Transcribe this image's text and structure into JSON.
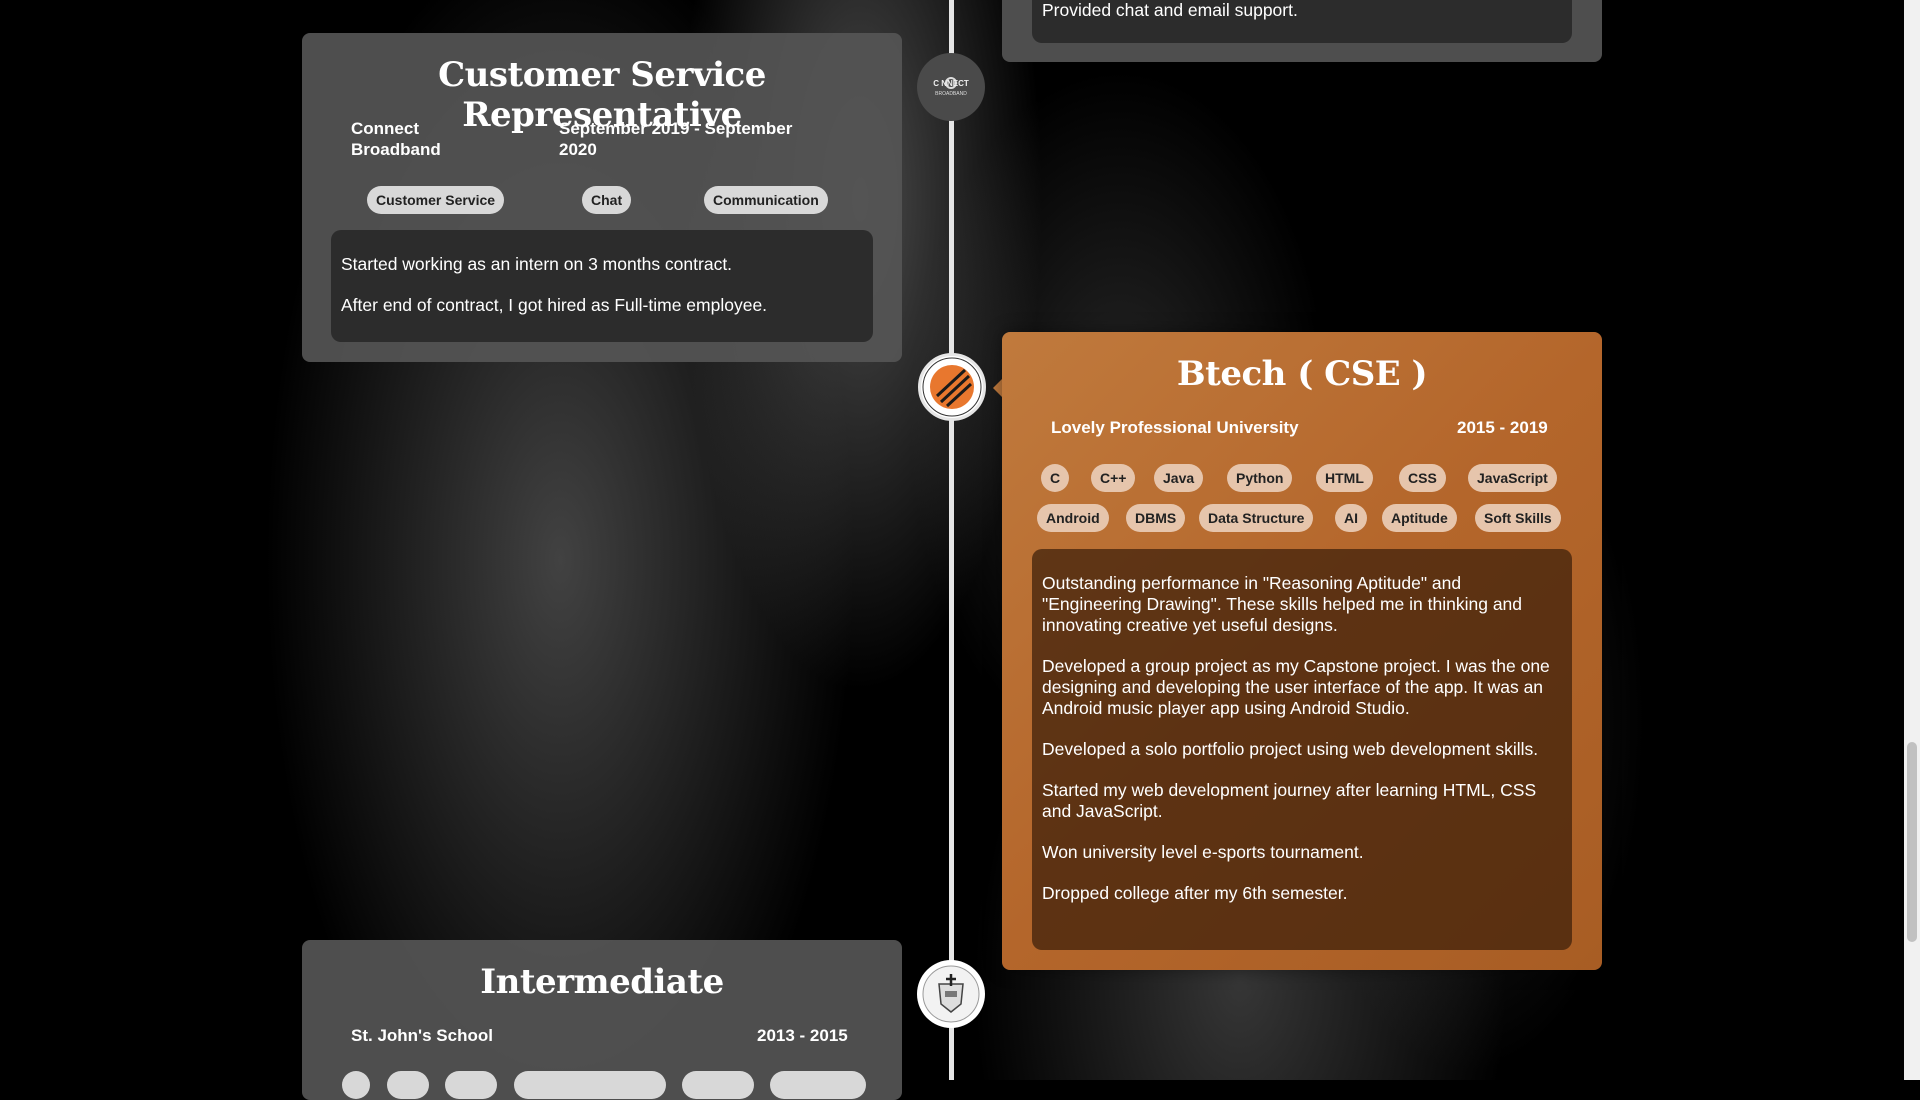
{
  "top_card": {
    "last_line": "Provided chat and email support."
  },
  "job_card": {
    "title": "Customer Service Representative",
    "company": "Connect Broadband",
    "company_line1": "Connect",
    "company_line2": "Broadband",
    "dates_line1": "September 2019 - September",
    "dates_line2": "2020",
    "tags": [
      "Customer Service",
      "Chat",
      "Communication"
    ],
    "paragraphs": [
      "Started working as an intern on 3 months contract.",
      "After end of contract, I got hired as Full-time employee."
    ],
    "logo_text_top": "C NNECT",
    "logo_text_bottom": "BROADBAND"
  },
  "education_card": {
    "title": "Btech ( CSE )",
    "institution": "Lovely Professional University",
    "years": "2015 - 2019",
    "tags_row1": [
      "C",
      "C++",
      "Java",
      "Python",
      "HTML",
      "CSS",
      "JavaScript"
    ],
    "tags_row2": [
      "Android",
      "DBMS",
      "Data Structure",
      "AI",
      "Aptitude",
      "Soft Skills"
    ],
    "paragraphs": [
      "Outstanding performance in \"Reasoning Aptitude\" and \"Engineering Drawing\". These skills helped me in thinking and innovating creative yet useful designs.",
      "Developed a group project as my Capstone project. I was the one designing and developing the user interface of the app. It was an Android music player app using Android Studio.",
      "Developed a solo portfolio project using web development skills.",
      "Started my web development journey after learning HTML, CSS and JavaScript.",
      "Won university level e-sports tournament.",
      "Dropped college after my 6th semester."
    ]
  },
  "intermediate_card": {
    "title": "Intermediate",
    "school": "St. John's School",
    "years": "2013 - 2015"
  },
  "colors": {
    "accent_orange": "#b4662b",
    "card_gray": "#555555",
    "timeline": "#e6e6e6"
  }
}
